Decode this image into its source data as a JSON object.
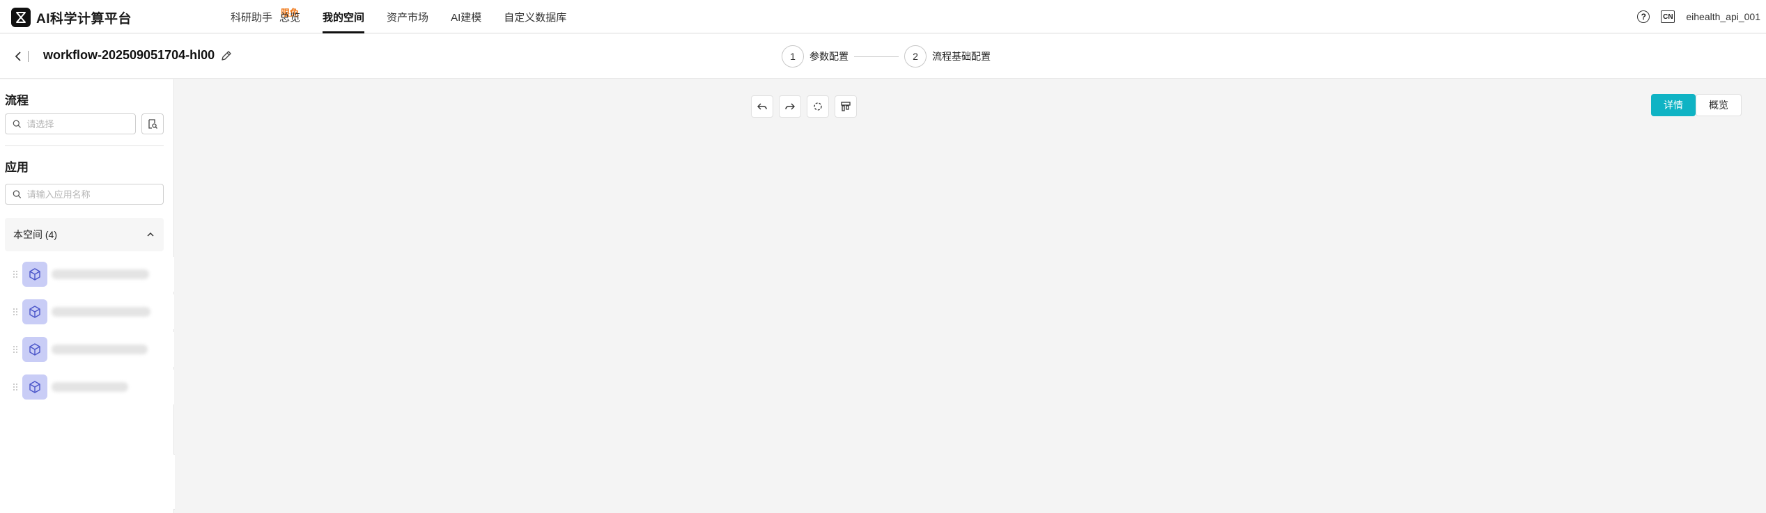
{
  "brand": {
    "title": "AI科学计算平台"
  },
  "nav": {
    "items": [
      {
        "label": "科研助手",
        "badge": "限免"
      },
      {
        "label": "总览"
      },
      {
        "label": "我的空间",
        "active": true
      },
      {
        "label": "资产市场"
      },
      {
        "label": "AI建模"
      },
      {
        "label": "自定义数据库"
      }
    ],
    "lang": "CN",
    "username": "eihealth_api_001"
  },
  "workflow": {
    "title": "workflow-202509051704-hl00",
    "steps": [
      {
        "number": "1",
        "label": "参数配置"
      },
      {
        "number": "2",
        "label": "流程基础配置"
      }
    ]
  },
  "sidebar": {
    "flow_title": "流程",
    "flow_search_placeholder": "请选择",
    "app_title": "应用",
    "app_search_placeholder": "请输入应用名称",
    "group_label": "本空间 (4)",
    "apps": [
      {
        "icon": "cube-icon"
      },
      {
        "icon": "cube-icon"
      },
      {
        "icon": "cube-icon"
      },
      {
        "icon": "cube-icon"
      }
    ]
  },
  "canvas": {
    "toolbar": [
      "undo-icon",
      "redo-icon",
      "reset-icon",
      "layout-icon"
    ],
    "view_tabs": [
      {
        "label": "详情",
        "active": true
      },
      {
        "label": "概览",
        "active": false
      }
    ]
  },
  "colors": {
    "accent": "#0fb3c4",
    "badge": "#f07a1b",
    "app_icon_bg": "#c9cdf6"
  }
}
